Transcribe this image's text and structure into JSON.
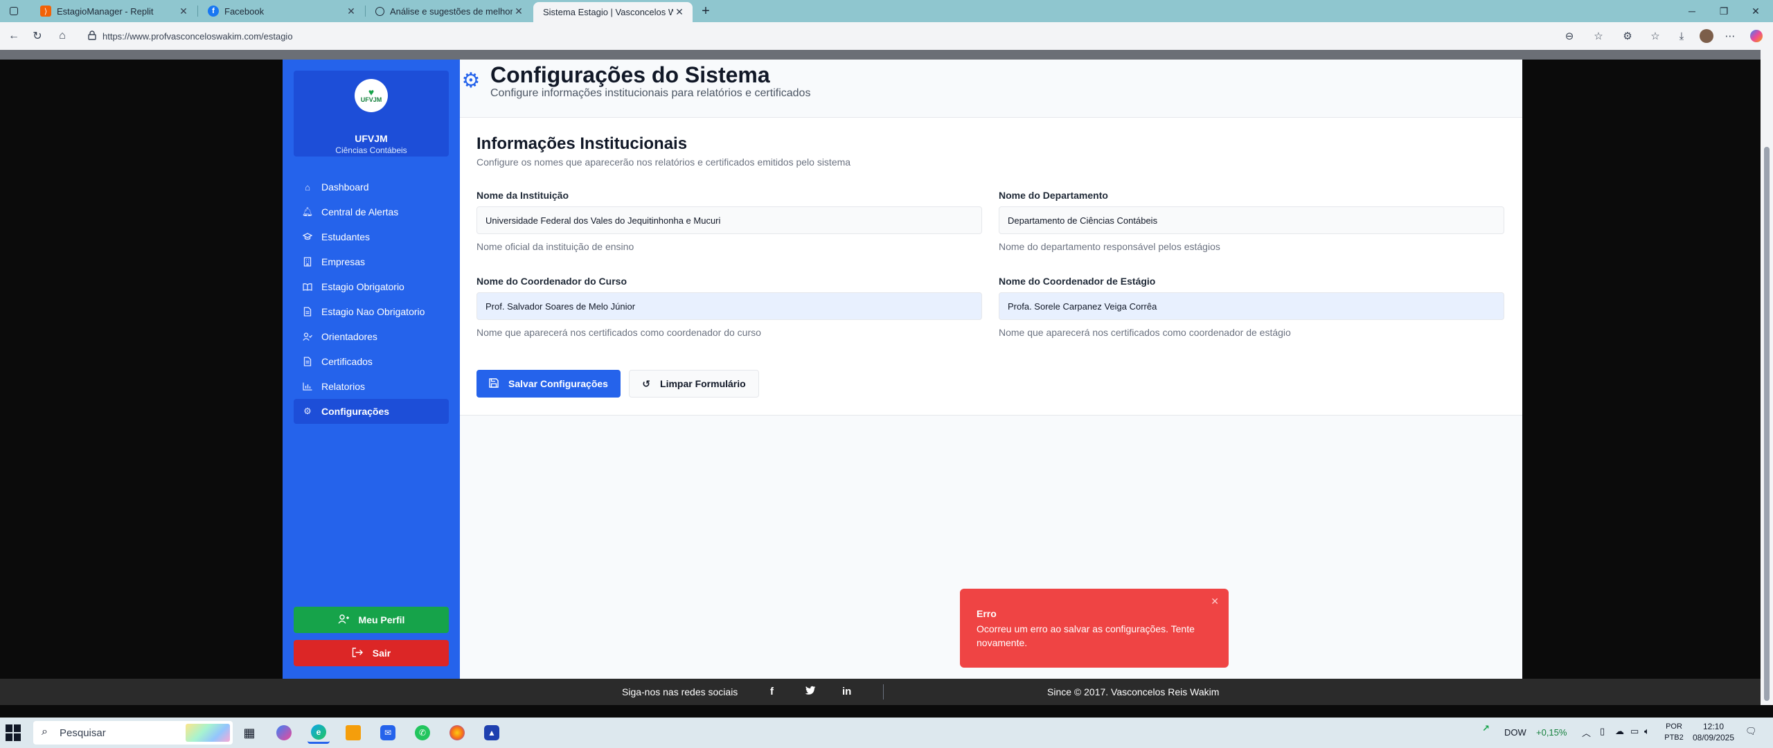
{
  "browser": {
    "tabs": [
      {
        "title": "EstagioManager - Replit",
        "favicon": "replit-icon"
      },
      {
        "title": "Facebook",
        "favicon": "facebook-icon"
      },
      {
        "title": "Análise e sugestões de melhoria",
        "favicon": "chatgpt-icon"
      },
      {
        "title": "Sistema Estagio | Vasconcelos Wa",
        "favicon": "page-icon"
      }
    ],
    "url": "https://www.profvasconceloswakim.com/estagio"
  },
  "sidebar": {
    "logo_text": "UFVJM",
    "org_name": "UFVJM",
    "org_subtitle": "Ciências Contábeis",
    "items": [
      {
        "label": "Dashboard",
        "icon": "home-icon"
      },
      {
        "label": "Central de Alertas",
        "icon": "bell-icon"
      },
      {
        "label": "Estudantes",
        "icon": "graduation-cap-icon"
      },
      {
        "label": "Empresas",
        "icon": "building-icon"
      },
      {
        "label": "Estagio Obrigatorio",
        "icon": "book-open-icon"
      },
      {
        "label": "Estagio Nao Obrigatorio",
        "icon": "file-text-icon"
      },
      {
        "label": "Orientadores",
        "icon": "user-check-icon"
      },
      {
        "label": "Certificados",
        "icon": "file-icon"
      },
      {
        "label": "Relatorios",
        "icon": "bar-chart-icon"
      },
      {
        "label": "Configurações",
        "icon": "gear-icon",
        "active": true
      }
    ],
    "profile_label": "Meu Perfil",
    "logout_label": "Sair"
  },
  "header": {
    "title": "Configurações do Sistema",
    "subtitle": "Configure informações institucionais para relatórios e certificados"
  },
  "section": {
    "title": "Informações Institucionais",
    "subtitle": "Configure os nomes que aparecerão nos relatórios e certificados emitidos pelo sistema",
    "fields": {
      "institution": {
        "label": "Nome da Instituição",
        "value": "Universidade Federal dos Vales do Jequitinhonha e Mucuri",
        "help": "Nome oficial da instituição de ensino"
      },
      "department": {
        "label": "Nome do Departamento",
        "value": "Departamento de Ciências Contábeis",
        "help": "Nome do departamento responsável pelos estágios"
      },
      "course_coordinator": {
        "label": "Nome do Coordenador do Curso",
        "value": "Prof. Salvador Soares de Melo Júnior",
        "help": "Nome que aparecerá nos certificados como coordenador do curso"
      },
      "internship_coordinator": {
        "label": "Nome do Coordenador de Estágio",
        "value": "Profa. Sorele Carpanez Veiga Corrêa",
        "help": "Nome que aparecerá nos certificados como coordenador de estágio"
      }
    },
    "save_label": "Salvar Configurações",
    "clear_label": "Limpar Formulário"
  },
  "toast": {
    "title": "Erro",
    "message": "Ocorreu um erro ao salvar as configurações. Tente novamente."
  },
  "footer": {
    "social_text": "Siga-nos nas redes sociais",
    "copyright": "Since © 2017.  Vasconcelos Reis Wakim"
  },
  "taskbar": {
    "search_placeholder": "Pesquisar",
    "stock_name": "DOW",
    "stock_change": "+0,15%",
    "lang_1": "POR",
    "lang_2": "PTB2",
    "time": "12:10",
    "date": "08/09/2025"
  },
  "colors": {
    "sidebar": "#2563eb",
    "primary": "#2563eb",
    "success": "#16a34a",
    "danger": "#dc2626",
    "toast": "#ef4444"
  }
}
